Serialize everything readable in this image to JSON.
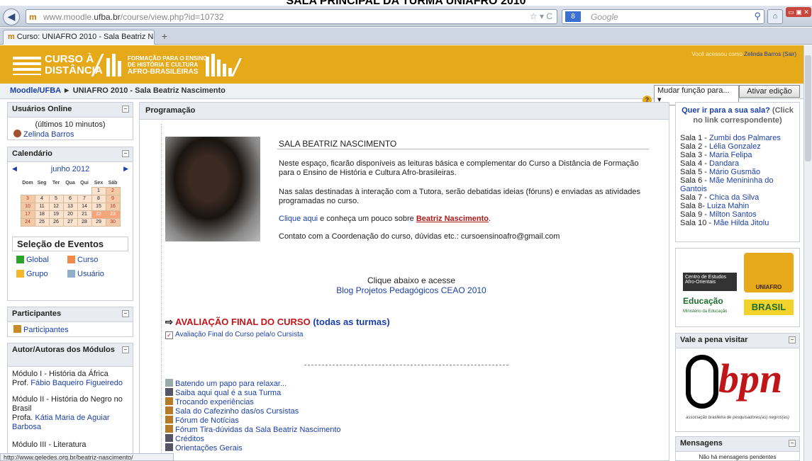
{
  "caption": "SALA PRINCIPAL DA TURMA UNIAFRO 2010",
  "browser": {
    "url_host": "www.moodle.",
    "url_domain": "ufba.br",
    "url_path": "/course/view.php?id=10732",
    "search_placeholder": "Google",
    "tab_title": "Curso: UNIAFRO 2010 - Sala Beatriz Nasc..."
  },
  "banner": {
    "logo_main_line1": "CURSO À",
    "logo_main_line2": "DISTÂNCIA",
    "logo_sub_line1": "FORMAÇÃO PARA O ENSINO",
    "logo_sub_line2": "DE HISTÓRIA E CULTURA",
    "logo_sub_line3": "AFRO-BRASILEIRAS",
    "login_prefix": "Você acessou como",
    "login_user": "Zelinda Barros",
    "login_exit": "(Sair)"
  },
  "breadcrumb": {
    "root": "Moodle/UFBA",
    "arrow": "►",
    "current": "UNIAFRO 2010 - Sala Beatriz Nascimento",
    "role_select": "Mudar função para...",
    "edit_button": "Ativar edição"
  },
  "online": {
    "title": "Usuários Online",
    "subtitle": "(últimos 10 minutos)",
    "user": "Zelinda Barros"
  },
  "calendar": {
    "title": "Calendário",
    "month": "junho 2012",
    "weekdays": [
      "Dom",
      "Seg",
      "Ter",
      "Qua",
      "Qui",
      "Sex",
      "Sáb"
    ],
    "weeks": [
      [
        "",
        "",
        "",
        "",
        "",
        "1",
        "2"
      ],
      [
        "3",
        "4",
        "5",
        "6",
        "7",
        "8",
        "9"
      ],
      [
        "10",
        "11",
        "12",
        "13",
        "14",
        "15",
        "16"
      ],
      [
        "17",
        "18",
        "19",
        "20",
        "21",
        "22",
        "23"
      ],
      [
        "24",
        "25",
        "26",
        "27",
        "28",
        "29",
        "30"
      ]
    ],
    "events_title": "Seleção de Eventos",
    "event_global": "Global",
    "event_curso": "Curso",
    "event_grupo": "Grupo",
    "event_usuario": "Usuário"
  },
  "participants": {
    "title": "Participantes",
    "link": "Participantes"
  },
  "authors": {
    "title": "Autor/Autoras dos Módulos",
    "m1": "Módulo I - História da África",
    "m1_prof": "Prof.",
    "m1_name": "Fábio Baqueiro Figueiredo",
    "m2": "Módulo II - História do Negro no Brasil",
    "m2_prof": "Profa.",
    "m2_name": "Kátia Maria de Aguiar Barbosa",
    "m3": "Módulo III - Literatura"
  },
  "main": {
    "heading": "Programação",
    "section_title": "SALA BEATRIZ NASCIMENTO",
    "p1": "Neste espaço, ficarão disponíveis as leituras básica e complementar do Curso a Distância de Formação para o Ensino de História e Cultura Afro-brasileiras.",
    "p2": "Nas salas destinadas à interação com a Tutora, serão debatidas ideias (fóruns) e enviadas as atividades programadas no curso.",
    "click_here": "Clique aqui",
    "know_text": " e conheça um pouco sobre ",
    "bn_link": "Beatriz Nascimento",
    "contact": "Contato com a Coordenação do curso, dúvidas etc.: cursoensinoafro@gmail.com",
    "blog_line1": "Clique abaixo e acesse",
    "blog_line2": "Blog Projetos Pedagógicos CEAO 2010",
    "aval_title": "AVALIAÇÃO FINAL DO CURSO",
    "aval_all": "(todas as turmas)",
    "aval_item": "Avaliação Final do Curso pela/o Cursista",
    "resources": [
      "Batendo um papo para relaxar...",
      "Saiba aqui qual é a sua Turma",
      "Trocando experiências",
      "Sala do Cafezinho das/os Cursistas",
      "Fórum de Notícias",
      "Fórum Tira-dúvidas da Sala Beatriz Nascimento",
      "Créditos",
      "Orientações Gerais"
    ]
  },
  "rooms": {
    "title": "Quer ir para a sua sala?",
    "hint": "(Click no link correspondente)",
    "list": [
      {
        "prefix": "Sala 1 - ",
        "name": "Zumbi dos Palmares"
      },
      {
        "prefix": "Sala 2 - ",
        "name": "Lélia Gonzalez"
      },
      {
        "prefix": "Sala 3 - ",
        "name": "Maria Felipa"
      },
      {
        "prefix": "Sala 4 - ",
        "name": "Dandara"
      },
      {
        "prefix": "Sala 5 - ",
        "name": "Mário Gusmão"
      },
      {
        "prefix": "Sala 6 - ",
        "name": "Mãe Menininha do Gantois"
      },
      {
        "prefix": "Sala 7 - ",
        "name": "Chica da Silva"
      },
      {
        "prefix": "Sala 8- ",
        "name": "Luiza Mahin"
      },
      {
        "prefix": "Sala 9 - ",
        "name": "Milton Santos"
      },
      {
        "prefix": "Sala 10 - ",
        "name": "Mãe Hilda Jitolu"
      }
    ]
  },
  "partners": {
    "ceao": "Centro de Estudos Afro-Orientais",
    "uniafro": "UNIAFRO",
    "educacao": "Educação",
    "ministerio": "Ministério da Educação",
    "brasil": "BRASIL"
  },
  "visit": {
    "title": "Vale a pena visitar",
    "bpn": "bpn",
    "bpn_sub": "associação brasileira de pesquisadores(as) negros(as)"
  },
  "messages": {
    "title": "Mensagens",
    "body": "Não há mensagens pendentes"
  },
  "status_url": "http://www.geledes.org.br/beatriz-nascimento/",
  "colors": {
    "banner": "#e5a91a",
    "link": "#1b3fa8",
    "alert": "#c0161a"
  }
}
